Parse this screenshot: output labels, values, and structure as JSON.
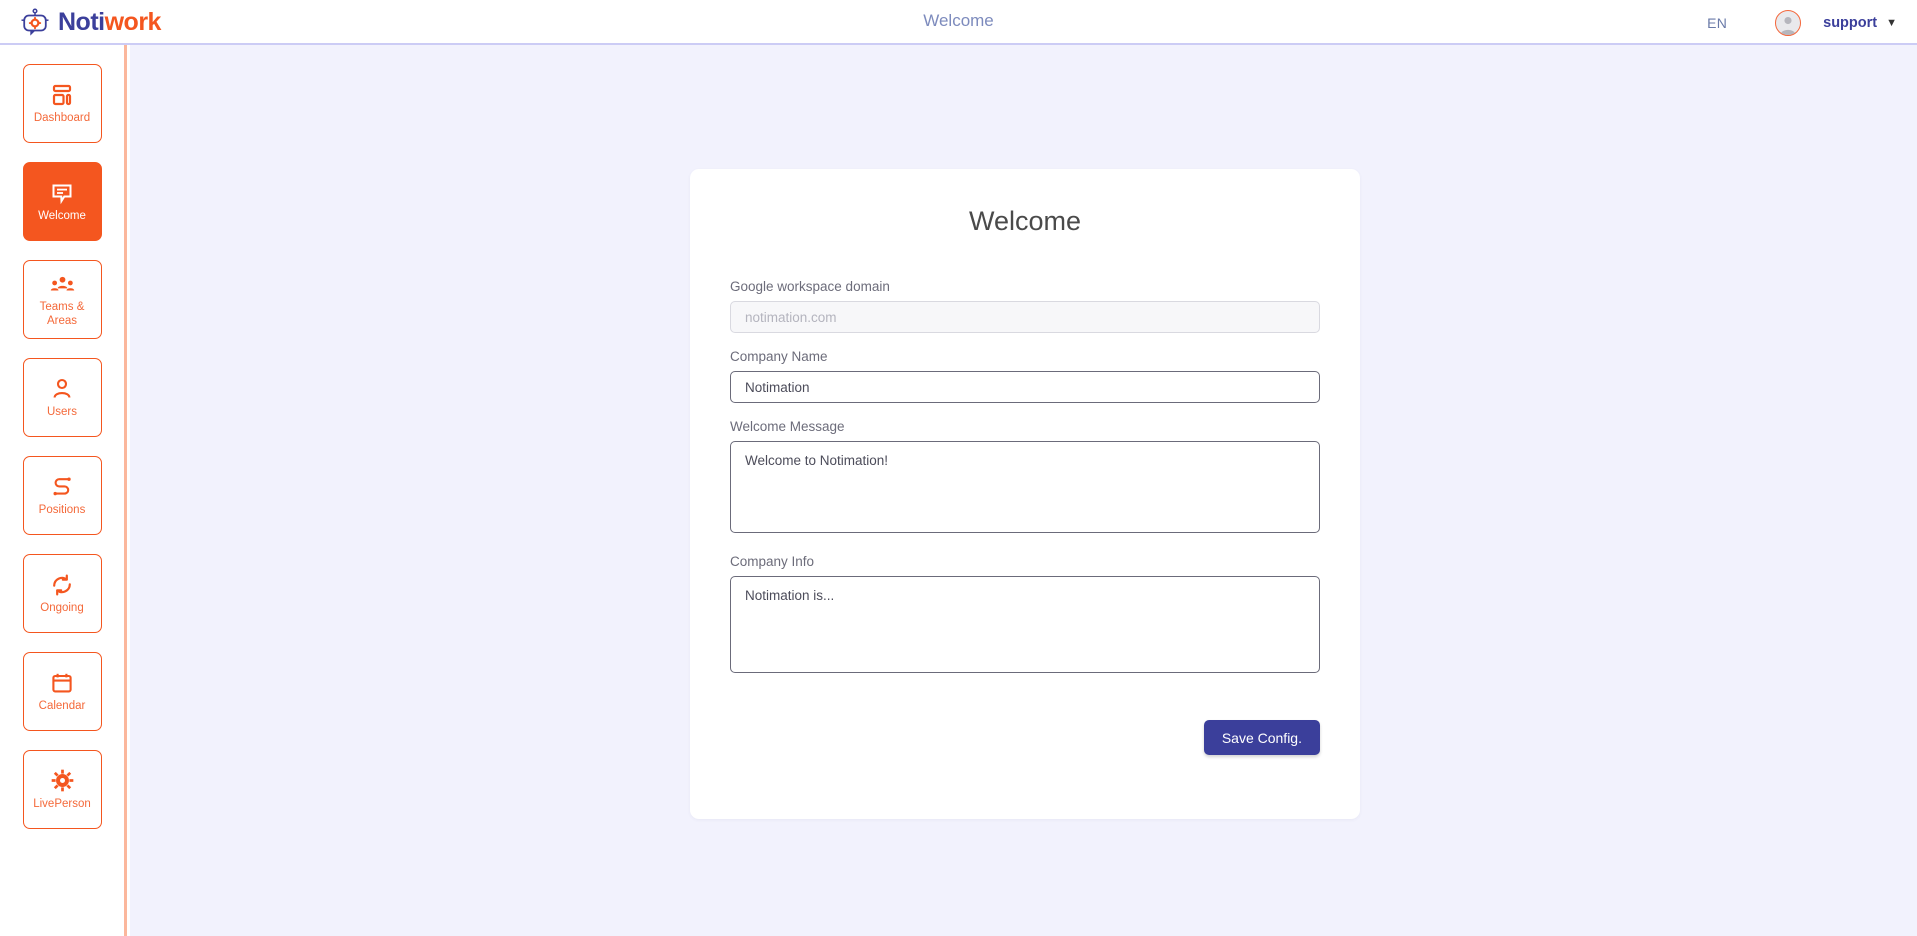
{
  "header": {
    "logo": {
      "icon": "robot-icon",
      "text_primary": "Noti",
      "text_accent": "work"
    },
    "title": "Welcome",
    "language": "EN",
    "avatar_icon": "user-avatar-icon",
    "user": "support",
    "caret": "▼"
  },
  "sidebar": {
    "items": [
      {
        "label": "Dashboard",
        "icon": "dashboard-icon",
        "active": false
      },
      {
        "label": "Welcome",
        "icon": "speech-bubble-icon",
        "active": true
      },
      {
        "label": "Teams & Areas",
        "icon": "teams-icon",
        "active": false
      },
      {
        "label": "Users",
        "icon": "user-icon",
        "active": false
      },
      {
        "label": "Positions",
        "icon": "route-icon",
        "active": false
      },
      {
        "label": "Ongoing",
        "icon": "refresh-icon",
        "active": false
      },
      {
        "label": "Calendar",
        "icon": "calendar-icon",
        "active": false
      },
      {
        "label": "LivePerson",
        "icon": "gear-sun-icon",
        "active": false
      }
    ]
  },
  "main": {
    "card_title": "Welcome",
    "fields": {
      "domain": {
        "label": "Google workspace domain",
        "value": "",
        "placeholder": "notimation.com"
      },
      "company_name": {
        "label": "Company Name",
        "value": "Notimation",
        "placeholder": ""
      },
      "welcome_message": {
        "label": "Welcome Message",
        "value": "Welcome to Notimation!",
        "placeholder": ""
      },
      "company_info": {
        "label": "Company Info",
        "value": "Notimation is...",
        "placeholder": ""
      }
    },
    "save_label": "Save Config."
  },
  "colors": {
    "accent_orange": "#f4561f",
    "brand_indigo": "#3b3f9b",
    "content_bg": "#f2f2fd",
    "header_border": "#ccccf5",
    "sidebar_divider": "#fbb79c"
  }
}
